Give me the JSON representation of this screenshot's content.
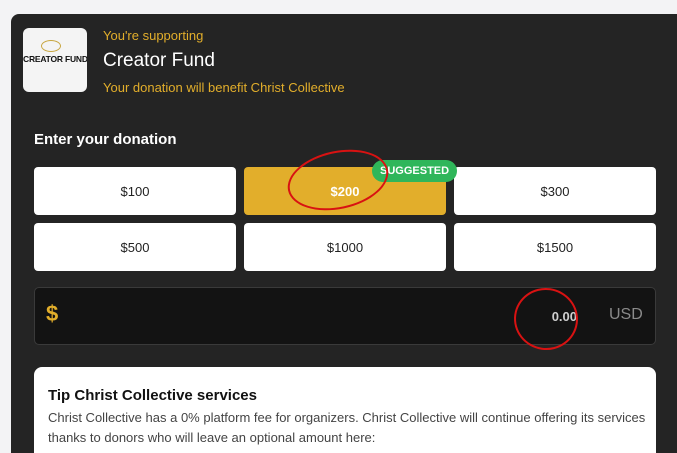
{
  "header": {
    "logo_text": "CREATOR FUND",
    "supporting_label": "You're supporting",
    "fund_title": "Creator Fund",
    "benefit_text": "Your donation will benefit Christ Collective"
  },
  "donation": {
    "label": "Enter your donation",
    "amounts": [
      "$100",
      "$200",
      "$300",
      "$500",
      "$1000",
      "$1500"
    ],
    "selected": "$200",
    "suggested_badge": "SUGGESTED",
    "currency_symbol": "$",
    "custom_value": "0.00",
    "currency": "USD"
  },
  "tip": {
    "title": "Tip Christ Collective services",
    "description": "Christ Collective has a 0% platform fee for organizers. Christ Collective will continue offering its services thanks to donors who will leave an optional amount here:"
  },
  "colors": {
    "accent": "#e2ae2b",
    "suggested": "#2fb65a",
    "panel": "#242424",
    "annotation": "#d81212"
  }
}
